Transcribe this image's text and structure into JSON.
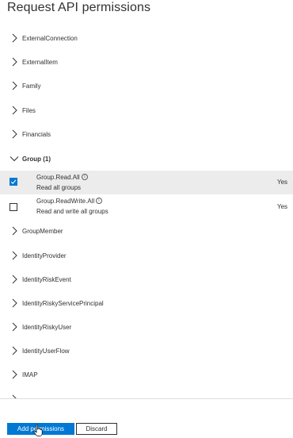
{
  "title": "Request API permissions",
  "categories_before": [
    {
      "label": "ExternalConnection",
      "expanded": false
    },
    {
      "label": "ExternalItem",
      "expanded": false
    },
    {
      "label": "Family",
      "expanded": false
    },
    {
      "label": "Files",
      "expanded": false
    },
    {
      "label": "Financials",
      "expanded": false
    }
  ],
  "group": {
    "label": "Group (1)",
    "expanded": true,
    "permissions": [
      {
        "name": "Group.Read.All",
        "description": "Read all groups",
        "admin_consent": "Yes",
        "checked": true
      },
      {
        "name": "Group.ReadWrite.All",
        "description": "Read and write all groups",
        "admin_consent": "Yes",
        "checked": false
      }
    ]
  },
  "categories_after": [
    {
      "label": "GroupMember",
      "expanded": false
    },
    {
      "label": "IdentityProvider",
      "expanded": false
    },
    {
      "label": "IdentityRiskEvent",
      "expanded": false
    },
    {
      "label": "IdentityRiskyServicePrincipal",
      "expanded": false
    },
    {
      "label": "IdentityRiskyUser",
      "expanded": false
    },
    {
      "label": "IdentityUserFlow",
      "expanded": false
    },
    {
      "label": "IMAP",
      "expanded": false
    },
    {
      "label": "",
      "expanded": false
    }
  ],
  "footer": {
    "add_label": "Add permissions",
    "discard_label": "Discard"
  },
  "colors": {
    "accent": "#0078d4",
    "selected_row": "#ececec"
  },
  "info_glyph": "i"
}
